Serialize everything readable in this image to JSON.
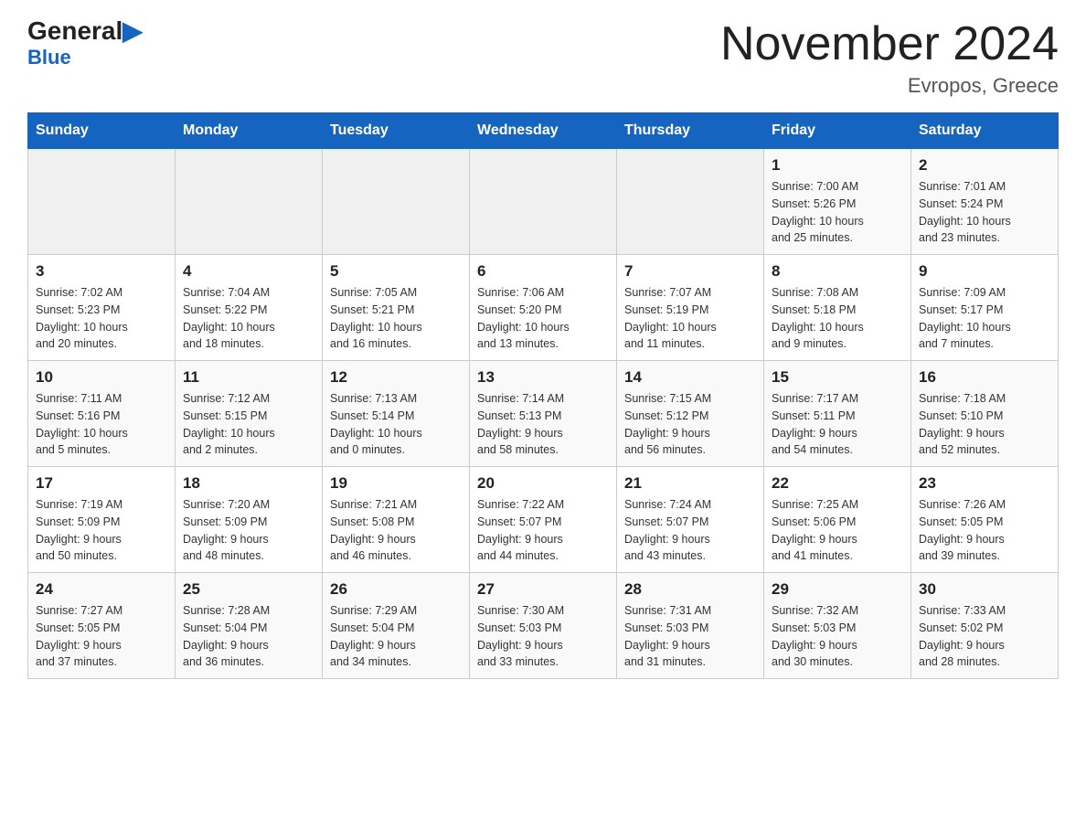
{
  "header": {
    "logo_general": "General",
    "logo_blue": "Blue",
    "title": "November 2024",
    "subtitle": "Evropos, Greece"
  },
  "weekdays": [
    "Sunday",
    "Monday",
    "Tuesday",
    "Wednesday",
    "Thursday",
    "Friday",
    "Saturday"
  ],
  "weeks": [
    [
      {
        "day": "",
        "info": ""
      },
      {
        "day": "",
        "info": ""
      },
      {
        "day": "",
        "info": ""
      },
      {
        "day": "",
        "info": ""
      },
      {
        "day": "",
        "info": ""
      },
      {
        "day": "1",
        "info": "Sunrise: 7:00 AM\nSunset: 5:26 PM\nDaylight: 10 hours\nand 25 minutes."
      },
      {
        "day": "2",
        "info": "Sunrise: 7:01 AM\nSunset: 5:24 PM\nDaylight: 10 hours\nand 23 minutes."
      }
    ],
    [
      {
        "day": "3",
        "info": "Sunrise: 7:02 AM\nSunset: 5:23 PM\nDaylight: 10 hours\nand 20 minutes."
      },
      {
        "day": "4",
        "info": "Sunrise: 7:04 AM\nSunset: 5:22 PM\nDaylight: 10 hours\nand 18 minutes."
      },
      {
        "day": "5",
        "info": "Sunrise: 7:05 AM\nSunset: 5:21 PM\nDaylight: 10 hours\nand 16 minutes."
      },
      {
        "day": "6",
        "info": "Sunrise: 7:06 AM\nSunset: 5:20 PM\nDaylight: 10 hours\nand 13 minutes."
      },
      {
        "day": "7",
        "info": "Sunrise: 7:07 AM\nSunset: 5:19 PM\nDaylight: 10 hours\nand 11 minutes."
      },
      {
        "day": "8",
        "info": "Sunrise: 7:08 AM\nSunset: 5:18 PM\nDaylight: 10 hours\nand 9 minutes."
      },
      {
        "day": "9",
        "info": "Sunrise: 7:09 AM\nSunset: 5:17 PM\nDaylight: 10 hours\nand 7 minutes."
      }
    ],
    [
      {
        "day": "10",
        "info": "Sunrise: 7:11 AM\nSunset: 5:16 PM\nDaylight: 10 hours\nand 5 minutes."
      },
      {
        "day": "11",
        "info": "Sunrise: 7:12 AM\nSunset: 5:15 PM\nDaylight: 10 hours\nand 2 minutes."
      },
      {
        "day": "12",
        "info": "Sunrise: 7:13 AM\nSunset: 5:14 PM\nDaylight: 10 hours\nand 0 minutes."
      },
      {
        "day": "13",
        "info": "Sunrise: 7:14 AM\nSunset: 5:13 PM\nDaylight: 9 hours\nand 58 minutes."
      },
      {
        "day": "14",
        "info": "Sunrise: 7:15 AM\nSunset: 5:12 PM\nDaylight: 9 hours\nand 56 minutes."
      },
      {
        "day": "15",
        "info": "Sunrise: 7:17 AM\nSunset: 5:11 PM\nDaylight: 9 hours\nand 54 minutes."
      },
      {
        "day": "16",
        "info": "Sunrise: 7:18 AM\nSunset: 5:10 PM\nDaylight: 9 hours\nand 52 minutes."
      }
    ],
    [
      {
        "day": "17",
        "info": "Sunrise: 7:19 AM\nSunset: 5:09 PM\nDaylight: 9 hours\nand 50 minutes."
      },
      {
        "day": "18",
        "info": "Sunrise: 7:20 AM\nSunset: 5:09 PM\nDaylight: 9 hours\nand 48 minutes."
      },
      {
        "day": "19",
        "info": "Sunrise: 7:21 AM\nSunset: 5:08 PM\nDaylight: 9 hours\nand 46 minutes."
      },
      {
        "day": "20",
        "info": "Sunrise: 7:22 AM\nSunset: 5:07 PM\nDaylight: 9 hours\nand 44 minutes."
      },
      {
        "day": "21",
        "info": "Sunrise: 7:24 AM\nSunset: 5:07 PM\nDaylight: 9 hours\nand 43 minutes."
      },
      {
        "day": "22",
        "info": "Sunrise: 7:25 AM\nSunset: 5:06 PM\nDaylight: 9 hours\nand 41 minutes."
      },
      {
        "day": "23",
        "info": "Sunrise: 7:26 AM\nSunset: 5:05 PM\nDaylight: 9 hours\nand 39 minutes."
      }
    ],
    [
      {
        "day": "24",
        "info": "Sunrise: 7:27 AM\nSunset: 5:05 PM\nDaylight: 9 hours\nand 37 minutes."
      },
      {
        "day": "25",
        "info": "Sunrise: 7:28 AM\nSunset: 5:04 PM\nDaylight: 9 hours\nand 36 minutes."
      },
      {
        "day": "26",
        "info": "Sunrise: 7:29 AM\nSunset: 5:04 PM\nDaylight: 9 hours\nand 34 minutes."
      },
      {
        "day": "27",
        "info": "Sunrise: 7:30 AM\nSunset: 5:03 PM\nDaylight: 9 hours\nand 33 minutes."
      },
      {
        "day": "28",
        "info": "Sunrise: 7:31 AM\nSunset: 5:03 PM\nDaylight: 9 hours\nand 31 minutes."
      },
      {
        "day": "29",
        "info": "Sunrise: 7:32 AM\nSunset: 5:03 PM\nDaylight: 9 hours\nand 30 minutes."
      },
      {
        "day": "30",
        "info": "Sunrise: 7:33 AM\nSunset: 5:02 PM\nDaylight: 9 hours\nand 28 minutes."
      }
    ]
  ]
}
